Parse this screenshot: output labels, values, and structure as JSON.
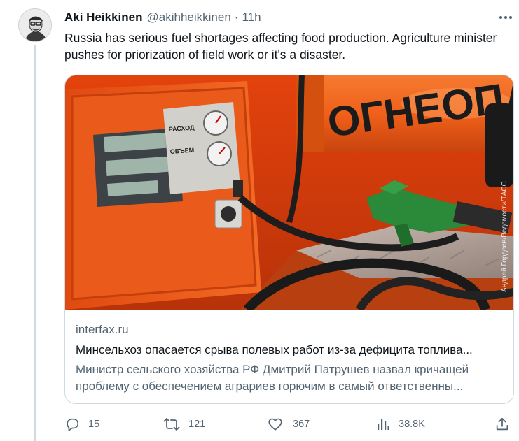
{
  "author": {
    "name": "Aki Heikkinen",
    "handle": "@akihheikkinen",
    "separator": "·",
    "time": "11h"
  },
  "tweet": {
    "text": "Russia has serious fuel shortages affecting food production. Agriculture minister pushes for priorization of field work or it's a disaster."
  },
  "card": {
    "domain": "interfax.ru",
    "title": "Минсельхоз опасается срыва полевых работ из-за дефицита топлива...",
    "description": "Министр сельского хозяйства РФ Дмитрий Патрушев назвал кричащей проблему с обеспечением аграриев горючим в самый ответственны...",
    "image": {
      "tank_text": "ОГНЕОПАСНО",
      "dispenser_label_1": "РАСХОД",
      "dispenser_label_2": "ОБЪЕМ",
      "credit": "Андрей Гордеев/Ведомости/ТАСС"
    }
  },
  "actions": {
    "replies": "15",
    "reposts": "121",
    "likes": "367",
    "views": "38.8K"
  },
  "colors": {
    "text": "#0f1419",
    "secondary": "#536471",
    "border": "#cfd9de",
    "orange": "#f05a14"
  }
}
